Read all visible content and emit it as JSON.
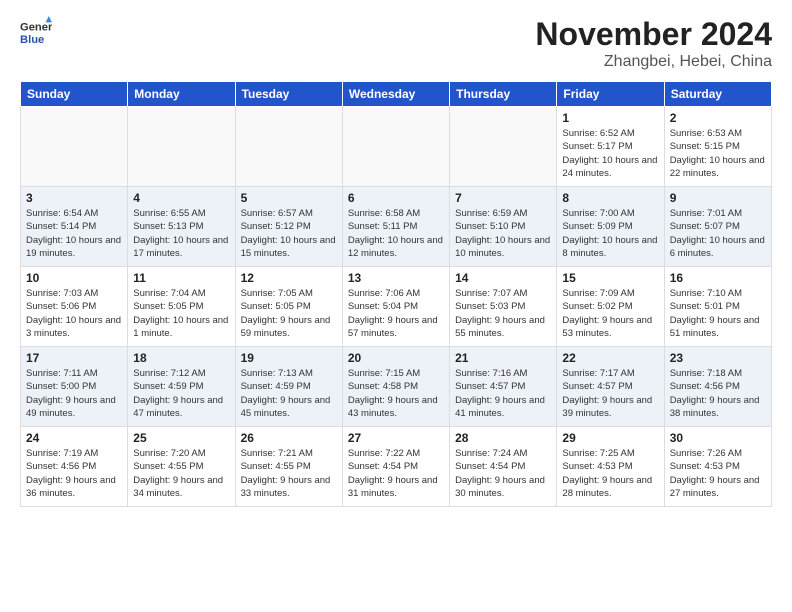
{
  "logo": {
    "general": "General",
    "blue": "Blue"
  },
  "title": "November 2024",
  "location": "Zhangbei, Hebei, China",
  "weekdays": [
    "Sunday",
    "Monday",
    "Tuesday",
    "Wednesday",
    "Thursday",
    "Friday",
    "Saturday"
  ],
  "weeks": [
    [
      {
        "day": "",
        "info": ""
      },
      {
        "day": "",
        "info": ""
      },
      {
        "day": "",
        "info": ""
      },
      {
        "day": "",
        "info": ""
      },
      {
        "day": "",
        "info": ""
      },
      {
        "day": "1",
        "info": "Sunrise: 6:52 AM\nSunset: 5:17 PM\nDaylight: 10 hours and 24 minutes."
      },
      {
        "day": "2",
        "info": "Sunrise: 6:53 AM\nSunset: 5:15 PM\nDaylight: 10 hours and 22 minutes."
      }
    ],
    [
      {
        "day": "3",
        "info": "Sunrise: 6:54 AM\nSunset: 5:14 PM\nDaylight: 10 hours and 19 minutes."
      },
      {
        "day": "4",
        "info": "Sunrise: 6:55 AM\nSunset: 5:13 PM\nDaylight: 10 hours and 17 minutes."
      },
      {
        "day": "5",
        "info": "Sunrise: 6:57 AM\nSunset: 5:12 PM\nDaylight: 10 hours and 15 minutes."
      },
      {
        "day": "6",
        "info": "Sunrise: 6:58 AM\nSunset: 5:11 PM\nDaylight: 10 hours and 12 minutes."
      },
      {
        "day": "7",
        "info": "Sunrise: 6:59 AM\nSunset: 5:10 PM\nDaylight: 10 hours and 10 minutes."
      },
      {
        "day": "8",
        "info": "Sunrise: 7:00 AM\nSunset: 5:09 PM\nDaylight: 10 hours and 8 minutes."
      },
      {
        "day": "9",
        "info": "Sunrise: 7:01 AM\nSunset: 5:07 PM\nDaylight: 10 hours and 6 minutes."
      }
    ],
    [
      {
        "day": "10",
        "info": "Sunrise: 7:03 AM\nSunset: 5:06 PM\nDaylight: 10 hours and 3 minutes."
      },
      {
        "day": "11",
        "info": "Sunrise: 7:04 AM\nSunset: 5:05 PM\nDaylight: 10 hours and 1 minute."
      },
      {
        "day": "12",
        "info": "Sunrise: 7:05 AM\nSunset: 5:05 PM\nDaylight: 9 hours and 59 minutes."
      },
      {
        "day": "13",
        "info": "Sunrise: 7:06 AM\nSunset: 5:04 PM\nDaylight: 9 hours and 57 minutes."
      },
      {
        "day": "14",
        "info": "Sunrise: 7:07 AM\nSunset: 5:03 PM\nDaylight: 9 hours and 55 minutes."
      },
      {
        "day": "15",
        "info": "Sunrise: 7:09 AM\nSunset: 5:02 PM\nDaylight: 9 hours and 53 minutes."
      },
      {
        "day": "16",
        "info": "Sunrise: 7:10 AM\nSunset: 5:01 PM\nDaylight: 9 hours and 51 minutes."
      }
    ],
    [
      {
        "day": "17",
        "info": "Sunrise: 7:11 AM\nSunset: 5:00 PM\nDaylight: 9 hours and 49 minutes."
      },
      {
        "day": "18",
        "info": "Sunrise: 7:12 AM\nSunset: 4:59 PM\nDaylight: 9 hours and 47 minutes."
      },
      {
        "day": "19",
        "info": "Sunrise: 7:13 AM\nSunset: 4:59 PM\nDaylight: 9 hours and 45 minutes."
      },
      {
        "day": "20",
        "info": "Sunrise: 7:15 AM\nSunset: 4:58 PM\nDaylight: 9 hours and 43 minutes."
      },
      {
        "day": "21",
        "info": "Sunrise: 7:16 AM\nSunset: 4:57 PM\nDaylight: 9 hours and 41 minutes."
      },
      {
        "day": "22",
        "info": "Sunrise: 7:17 AM\nSunset: 4:57 PM\nDaylight: 9 hours and 39 minutes."
      },
      {
        "day": "23",
        "info": "Sunrise: 7:18 AM\nSunset: 4:56 PM\nDaylight: 9 hours and 38 minutes."
      }
    ],
    [
      {
        "day": "24",
        "info": "Sunrise: 7:19 AM\nSunset: 4:56 PM\nDaylight: 9 hours and 36 minutes."
      },
      {
        "day": "25",
        "info": "Sunrise: 7:20 AM\nSunset: 4:55 PM\nDaylight: 9 hours and 34 minutes."
      },
      {
        "day": "26",
        "info": "Sunrise: 7:21 AM\nSunset: 4:55 PM\nDaylight: 9 hours and 33 minutes."
      },
      {
        "day": "27",
        "info": "Sunrise: 7:22 AM\nSunset: 4:54 PM\nDaylight: 9 hours and 31 minutes."
      },
      {
        "day": "28",
        "info": "Sunrise: 7:24 AM\nSunset: 4:54 PM\nDaylight: 9 hours and 30 minutes."
      },
      {
        "day": "29",
        "info": "Sunrise: 7:25 AM\nSunset: 4:53 PM\nDaylight: 9 hours and 28 minutes."
      },
      {
        "day": "30",
        "info": "Sunrise: 7:26 AM\nSunset: 4:53 PM\nDaylight: 9 hours and 27 minutes."
      }
    ]
  ]
}
